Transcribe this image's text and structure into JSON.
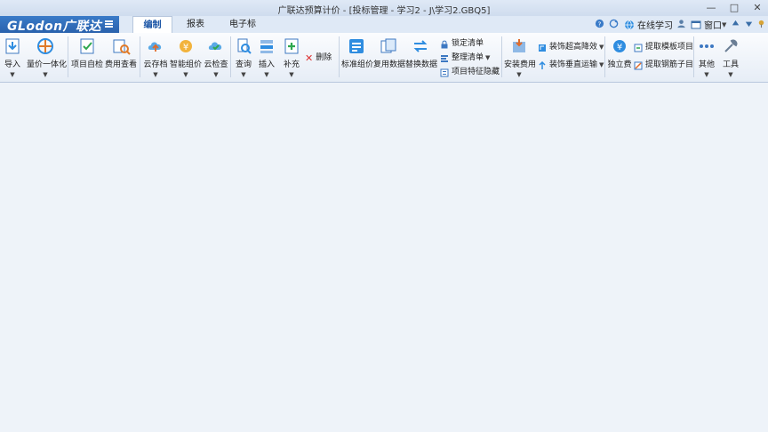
{
  "window": {
    "title": "广联达预算计价 - [投标管理 - 学习2 - J\\学习2.GBQ5]",
    "controls": [
      "—",
      "□",
      "✕"
    ]
  },
  "logo": {
    "text": "GLodon广联达"
  },
  "ribbon_tabs": [
    {
      "label": "编制",
      "active": true
    },
    {
      "label": "报表",
      "active": false
    },
    {
      "label": "电子标",
      "active": false
    }
  ],
  "right_tools": {
    "online_learning": "在线学习",
    "window": "窗口"
  },
  "toolbar": {
    "buttons": [
      {
        "label": "导入",
        "caret": true,
        "icon": "import-icon"
      },
      {
        "label": "量价一体化",
        "caret": true,
        "icon": "price-integration-icon"
      },
      {
        "label": "项目自检",
        "caret": false,
        "icon": "project-check-icon"
      },
      {
        "label": "费用查看",
        "caret": false,
        "icon": "cost-view-icon"
      },
      {
        "label": "云存档",
        "caret": true,
        "icon": "cloud-save-icon"
      },
      {
        "label": "智能组价",
        "caret": true,
        "icon": "smart-price-icon"
      },
      {
        "label": "云检查",
        "caret": true,
        "icon": "cloud-check-icon"
      },
      {
        "label": "查询",
        "caret": true,
        "icon": "query-icon"
      },
      {
        "label": "插入",
        "caret": true,
        "icon": "insert-icon"
      },
      {
        "label": "补充",
        "caret": true,
        "icon": "supplement-icon"
      },
      {
        "label": "标准组价",
        "caret": false,
        "icon": "standard-price-icon"
      },
      {
        "label": "复用数据",
        "caret": false,
        "icon": "reuse-data-icon"
      },
      {
        "label": "替换数据",
        "caret": false,
        "icon": "replace-data-icon"
      },
      {
        "label": "安装费用",
        "caret": true,
        "icon": "install-cost-icon"
      },
      {
        "label": "独立费",
        "caret": false,
        "icon": "independent-fee-icon"
      },
      {
        "label": "其他",
        "caret": true,
        "icon": "other-icon"
      },
      {
        "label": "工具",
        "caret": true,
        "icon": "tools-icon"
      }
    ],
    "delete_label": "删除",
    "small_cmds": [
      {
        "label": "锁定清单",
        "icon": "lock-icon"
      },
      {
        "label": "整理清单",
        "icon": "arrange-list-icon"
      },
      {
        "label": "项目特征隐藏",
        "icon": "feature-icon"
      },
      {
        "label": "装饰超高降效",
        "icon": "decoration-icon"
      },
      {
        "label": "装饰垂直运输",
        "icon": "vertical-transport-icon"
      },
      {
        "label": "提取模板项目",
        "icon": "extract-template-icon"
      },
      {
        "label": "提取钢筋子目",
        "icon": "extract-rebar-icon"
      }
    ]
  },
  "colors": {
    "logo_bg": "#2a62ad",
    "accent": "#1c56a6"
  }
}
